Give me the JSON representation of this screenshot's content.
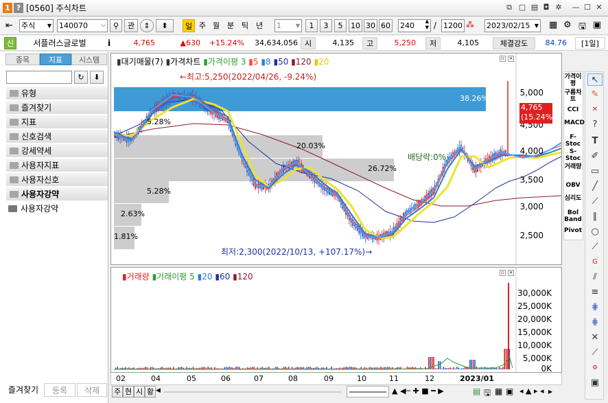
{
  "window": {
    "title": "[0560] 주식차트",
    "help_icon": "?",
    "number_icon": "1"
  },
  "toolbar": {
    "market": "주식",
    "code": "140070",
    "gwan": "관",
    "periods": [
      "일",
      "주",
      "월",
      "분",
      "틱",
      "년"
    ],
    "active_period": "일",
    "interval_value": "1",
    "quick_intervals": [
      "1",
      "3",
      "5",
      "10",
      "30",
      "60"
    ],
    "count": "240",
    "slash": "/",
    "total": "1200",
    "date": "2023/02/15"
  },
  "quote": {
    "sin_label": "신",
    "name": "서플러스글로벌",
    "info_icon": "i",
    "price": "4,765",
    "change": "▲630",
    "change_pct": "+15.24%",
    "volume": "34,634,056",
    "open_label": "시",
    "open": "4,135",
    "high_label": "고",
    "high": "5,250",
    "low_label": "저",
    "low": "4,105",
    "strength_label": "체결강도",
    "strength": "84.76",
    "period_tag": "[1일]"
  },
  "left_panel": {
    "tabs": [
      "종목",
      "지표",
      "시스템"
    ],
    "active_tab": "지표",
    "menu": [
      "유형",
      "즐겨찾기",
      "지표",
      "신호검색",
      "강세약세",
      "사용자지표",
      "사용자신호",
      "사용자강약"
    ],
    "tree_item": "사용자강약",
    "bottom_tabs": [
      "즐겨찾기",
      "등록",
      "삭제"
    ]
  },
  "chart": {
    "legend": [
      "대기매물(7)",
      "가격차트",
      "가격이평",
      "3",
      "5",
      "8",
      "50",
      "120",
      "20"
    ],
    "high_annot": "←최고:5,250(2022/04/26, -9.24%)",
    "low_annot": "최저:2,300(2022/10/13, +107.17%)→",
    "dividend_annot": "배당락:0%",
    "current_price": "4,765",
    "current_pct": "(15.24%)",
    "y_ticks": [
      "5,000",
      "4,500",
      "4,000",
      "3,500",
      "3,000",
      "2,500"
    ],
    "bands": [
      {
        "pct": "38.26%"
      },
      {
        "pct": "5.28%"
      },
      {
        "pct": "20.03%"
      },
      {
        "pct": "26.72%"
      },
      {
        "pct": "5.28%"
      },
      {
        "pct": "2.63%"
      },
      {
        "pct": "1.81%"
      }
    ],
    "colors": {
      "ma3": "#4aa3f0",
      "ma5": "#ff4040",
      "ma8": "#2a7fd4",
      "ma50": "#1e2f9e",
      "ma120": "#8b1a2a",
      "ma20": "#f0e22a",
      "band_blue": "#3e9bd6",
      "band_gray": "#c8c8c8"
    }
  },
  "volume": {
    "legend": [
      "거래량",
      "거래이평",
      "5",
      "20",
      "60",
      "120"
    ],
    "y_ticks": [
      "30,000K",
      "25,000K",
      "20,000K",
      "15,000K",
      "10,000K",
      "5,000K",
      "0K"
    ]
  },
  "x_axis": [
    "02",
    "04",
    "05",
    "06",
    "07",
    "08",
    "09",
    "10",
    "11",
    "12",
    "2023/01"
  ],
  "bottom_bar": {
    "buttons": [
      "주",
      "현",
      "시",
      "황"
    ]
  },
  "right_tools": [
    "가격이평",
    "구름차트",
    "CCI",
    "MACD",
    "F-Stoc",
    "S-Stoc",
    "거래량",
    "OBV",
    "심리도",
    "Bol Band",
    "Pivot"
  ]
}
